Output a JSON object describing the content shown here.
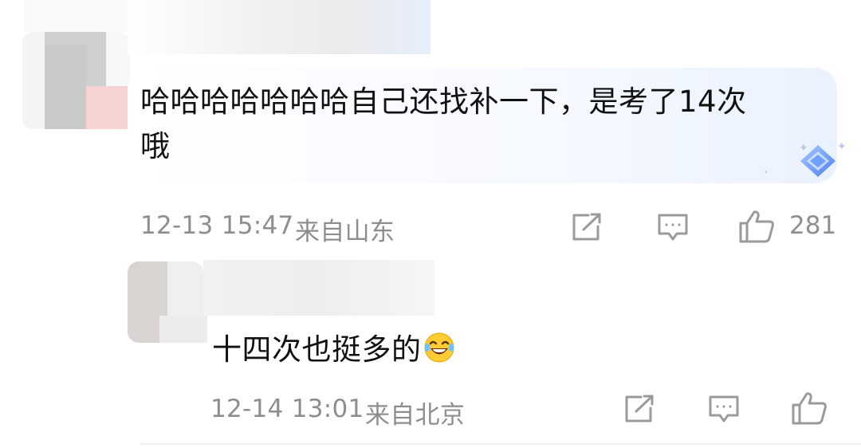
{
  "comments": [
    {
      "text_line1": "哈哈哈哈哈哈哈自己还找补一下，是考了14次",
      "text_line2": "哦",
      "time": "12-13 15:47",
      "location": "来自山东",
      "like_count": "281",
      "icons": [
        "share-icon",
        "comment-icon",
        "like-icon",
        "badge-icon"
      ]
    },
    {
      "text": "十四次也挺多的",
      "emoji": "😂",
      "time": "12-14 13:01",
      "location": "来自北京",
      "icons": [
        "share-icon",
        "comment-icon",
        "like-icon"
      ]
    }
  ],
  "colors": {
    "meta_text": "#8e8e8e",
    "body_text": "#111111",
    "icon_stroke": "#9a9a9a",
    "badge_blue": "#5b8ff9"
  }
}
